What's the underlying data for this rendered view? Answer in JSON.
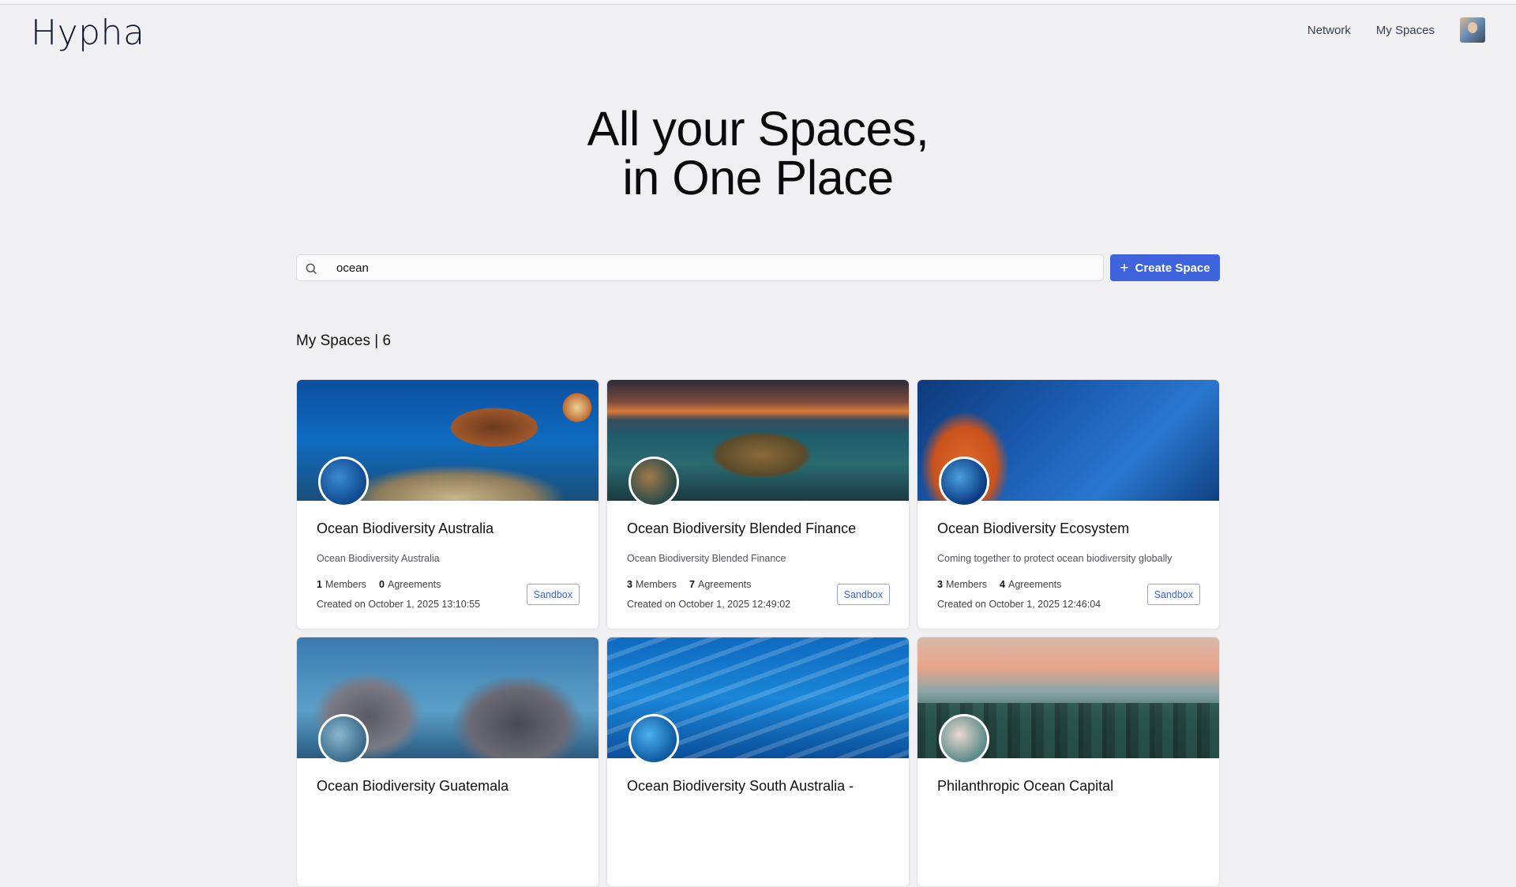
{
  "brand": {
    "logo_text": "Hypha"
  },
  "nav": {
    "network": "Network",
    "my_spaces": "My Spaces"
  },
  "hero": {
    "line1": "All your Spaces,",
    "line2": "in One Place"
  },
  "search": {
    "value": "ocean"
  },
  "create_button": {
    "label": "Create Space"
  },
  "section": {
    "title": "My Spaces | 6"
  },
  "labels": {
    "members": "Members",
    "agreements": "Agreements",
    "sandbox": "Sandbox"
  },
  "spaces": [
    {
      "title": "Ocean Biodiversity Australia",
      "description": "Ocean Biodiversity Australia",
      "members": "1",
      "agreements": "0",
      "created": "Created on October 1, 2025 13:10:55",
      "tag": "Sandbox"
    },
    {
      "title": "Ocean Biodiversity Blended Finance",
      "description": "Ocean Biodiversity Blended Finance",
      "members": "3",
      "agreements": "7",
      "created": "Created on October 1, 2025 12:49:02",
      "tag": "Sandbox"
    },
    {
      "title": "Ocean Biodiversity Ecosystem",
      "description": "Coming together to protect ocean biodiversity globally",
      "members": "3",
      "agreements": "4",
      "created": "Created on October 1, 2025 12:46:04",
      "tag": "Sandbox"
    },
    {
      "title": "Ocean Biodiversity Guatemala"
    },
    {
      "title": "Ocean Biodiversity South Australia -"
    },
    {
      "title": "Philanthropic Ocean Capital"
    }
  ]
}
